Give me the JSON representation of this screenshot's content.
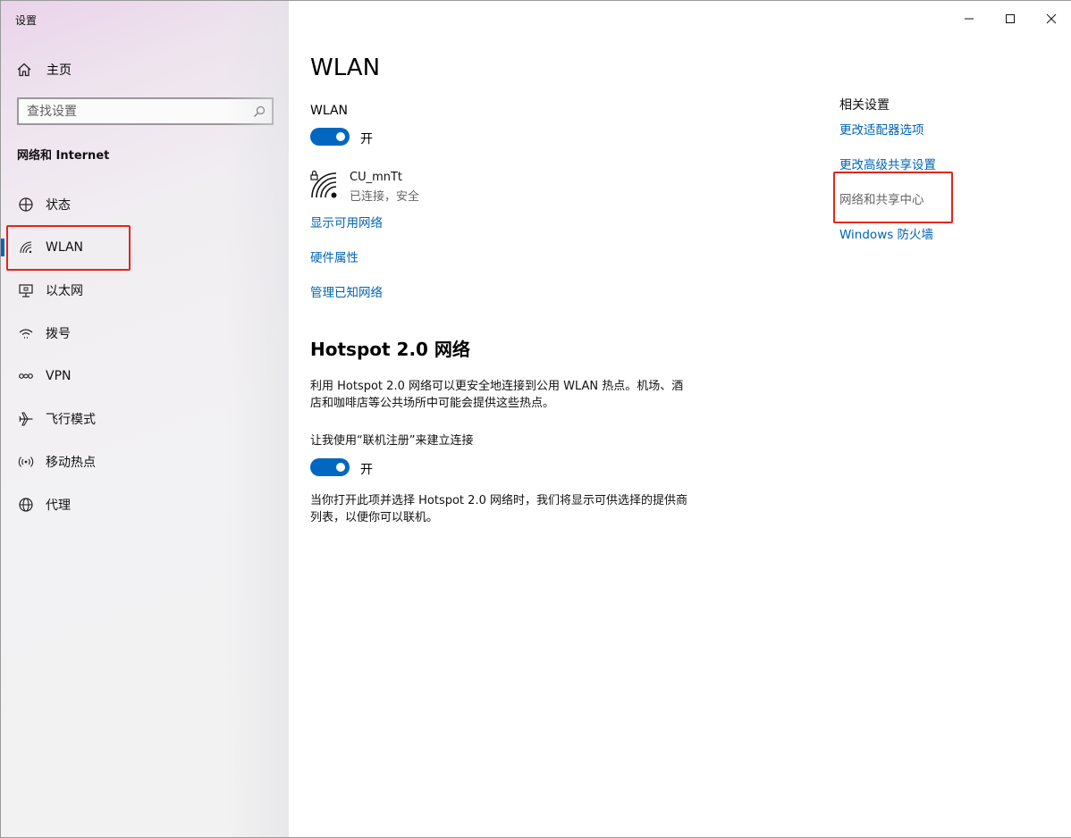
{
  "window": {
    "title": "设置"
  },
  "sidebar": {
    "home_label": "主页",
    "search_placeholder": "查找设置",
    "section_title": "网络和 Internet",
    "items": [
      {
        "label": "状态",
        "icon": "status-icon"
      },
      {
        "label": "WLAN",
        "icon": "wifi-icon",
        "selected": true
      },
      {
        "label": "以太网",
        "icon": "ethernet-icon"
      },
      {
        "label": "拨号",
        "icon": "dialup-icon"
      },
      {
        "label": "VPN",
        "icon": "vpn-icon"
      },
      {
        "label": "飞行模式",
        "icon": "airplane-icon"
      },
      {
        "label": "移动热点",
        "icon": "hotspot-icon"
      },
      {
        "label": "代理",
        "icon": "globe-icon"
      }
    ]
  },
  "main": {
    "title": "WLAN",
    "wlan_label": "WLAN",
    "wlan_toggle_text": "开",
    "network": {
      "name": "CU_mnTt",
      "status": "已连接，安全"
    },
    "links": {
      "show_available": "显示可用网络",
      "hardware_props": "硬件属性",
      "manage_known": "管理已知网络"
    },
    "hotspot": {
      "title": "Hotspot 2.0 网络",
      "description_line1": "利用 Hotspot 2.0 网络可以更安全地连接到公用 WLAN 热点。机场、酒",
      "description_line2": "店和咖啡店等公共场所中可能会提供这些热点。",
      "signup_label": "让我使用“联机注册”来建立连接",
      "signup_toggle_text": "开",
      "note_line1": "当你打开此项并选择 Hotspot 2.0 网络时，我们将显示可供选择的提供商",
      "note_line2": "列表，以便你可以联机。"
    }
  },
  "related": {
    "title": "相关设置",
    "links": [
      "更改适配器选项",
      "更改高级共享设置",
      "网络和共享中心",
      "Windows 防火墙"
    ]
  },
  "colors": {
    "accent": "#0067c0",
    "link": "#0063b1",
    "highlight_box": "#e0271c"
  }
}
